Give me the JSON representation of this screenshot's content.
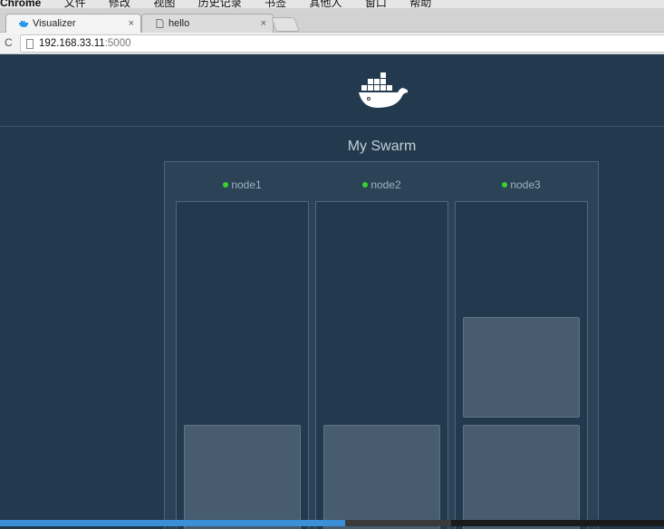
{
  "menubar": {
    "items": [
      "Chrome",
      "文件",
      "修改",
      "视图",
      "历史记录",
      "书签",
      "其他人",
      "窗口",
      "帮助"
    ]
  },
  "tabs": [
    {
      "title": "Visualizer",
      "favicon": "docker-whale-icon",
      "close": "×",
      "active": true
    },
    {
      "title": "hello",
      "favicon": "page-icon",
      "close": "×",
      "active": false
    }
  ],
  "address": {
    "reload_icon": "C",
    "host": "192.168.33.11",
    "port": ":5000"
  },
  "page": {
    "logo": "docker-whale-icon",
    "swarm_title": "My Swarm",
    "nodes": [
      {
        "name": "node1",
        "status_color": "#3ad12e",
        "tasks": 1
      },
      {
        "name": "node2",
        "status_color": "#3ad12e",
        "tasks": 1
      },
      {
        "name": "node3",
        "status_color": "#3ad12e",
        "tasks": 2
      }
    ]
  },
  "colors": {
    "background": "#233a4e",
    "accent_progress": "#3a8fd6",
    "status_green": "#3ad12e"
  },
  "progress": {
    "fraction": 0.52
  }
}
